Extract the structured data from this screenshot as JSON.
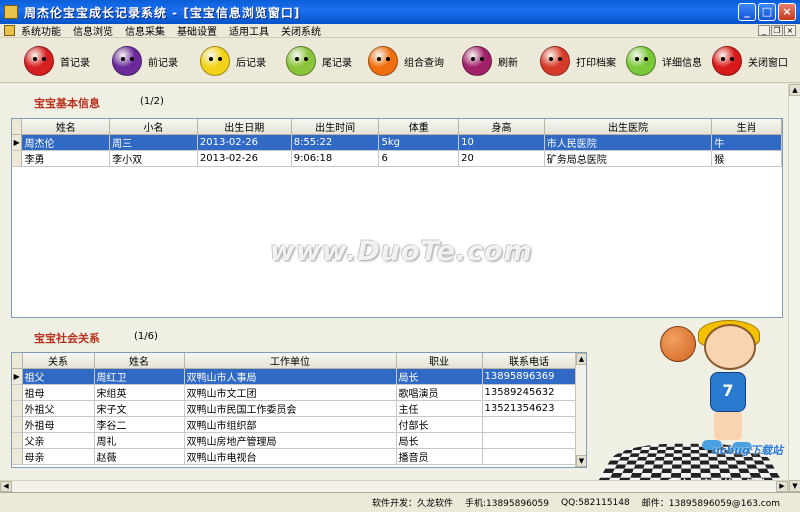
{
  "window": {
    "title": "周杰伦宝宝成长记录系统 - [宝宝信息浏览窗口]"
  },
  "menu": [
    "系统功能",
    "信息浏览",
    "信息采集",
    "基础设置",
    "适用工具",
    "关闭系统"
  ],
  "toolbar": [
    {
      "label": "首记录",
      "icon": "cherry-icon",
      "color": "#d42020"
    },
    {
      "label": "前记录",
      "icon": "purple-fruit-icon",
      "color": "#6a2a9a"
    },
    {
      "label": "后记录",
      "icon": "lemon-icon",
      "color": "#f2d218"
    },
    {
      "label": "尾记录",
      "icon": "lime-icon",
      "color": "#8ac43a"
    },
    {
      "label": "组合查询",
      "icon": "orange-icon",
      "color": "#f07010"
    },
    {
      "label": "刷新",
      "icon": "berry-icon",
      "color": "#a0206a"
    },
    {
      "label": "打印档案",
      "icon": "strawberry-icon",
      "color": "#d83a2a"
    },
    {
      "label": "详细信息",
      "icon": "green-apple-icon",
      "color": "#7ac83a"
    },
    {
      "label": "关闭窗口",
      "icon": "red-apple-icon",
      "color": "#d81a1a"
    }
  ],
  "baby_info": {
    "title": "宝宝基本信息",
    "count": "(1/2)",
    "columns": [
      "姓名",
      "小名",
      "出生日期",
      "出生时间",
      "体重",
      "身高",
      "出生医院",
      "生肖"
    ],
    "rows": [
      [
        "周杰伦",
        "周三",
        "2013-02-26",
        "8:55:22",
        "5kg",
        "10",
        "市人民医院",
        "牛"
      ],
      [
        "李勇",
        "李小双",
        "2013-02-26",
        "9:06:18",
        "6",
        "20",
        "矿务局总医院",
        "猴"
      ]
    ]
  },
  "social": {
    "title": "宝宝社会关系",
    "count": "(1/6)",
    "columns": [
      "关系",
      "姓名",
      "工作单位",
      "职业",
      "联系电话"
    ],
    "rows": [
      [
        "祖父",
        "周红卫",
        "双鸭山市人事局",
        "局长",
        "13895896369"
      ],
      [
        "祖母",
        "宋组英",
        "双鸭山市文工团",
        "歌唱演员",
        "13589245632"
      ],
      [
        "外祖父",
        "宋子文",
        "双鸭山市民国工作委员会",
        "主任",
        "13521354623"
      ],
      [
        "外祖母",
        "李谷二",
        "双鸭山市组织部",
        "付部长",
        ""
      ],
      [
        "父亲",
        "周礼",
        "双鸭山房地产管理局",
        "局长",
        ""
      ],
      [
        "母亲",
        "赵薇",
        "双鸭山市电视台",
        "播音员",
        ""
      ]
    ]
  },
  "watermark": "www.DuoTe.com",
  "illustration": {
    "jersey_number": "7",
    "logo": "ucbug下载站",
    "tag": "国内最安全的软件站"
  },
  "status": {
    "dev": "软件开发：久龙软件",
    "phone": "手机:13895896059",
    "qq": "QQ:582115148",
    "email": "邮件：13895896059@163.com"
  }
}
